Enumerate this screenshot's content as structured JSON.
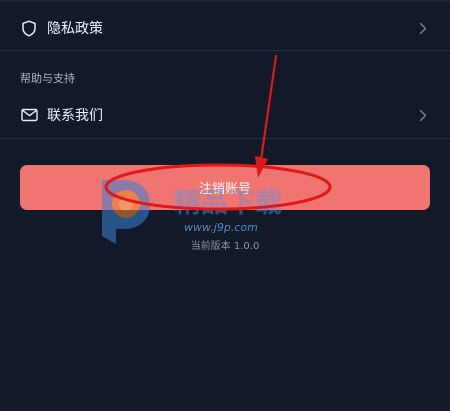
{
  "settings": {
    "privacy_policy_label": "隐私政策",
    "help_section_title": "帮助与支持",
    "contact_us_label": "联系我们"
  },
  "actions": {
    "logout_label": "注销账号"
  },
  "footer": {
    "version_text": "当前版本 1.0.0"
  },
  "watermark": {
    "brand_text": "精品下载",
    "url_text": "www.j9p.com"
  },
  "icons": {
    "privacy": "shield-icon",
    "contact": "mail-icon",
    "chevron": "chevron-right-icon"
  },
  "colors": {
    "background": "#121a2a",
    "button": "#f07470",
    "annotation": "#e01818"
  }
}
